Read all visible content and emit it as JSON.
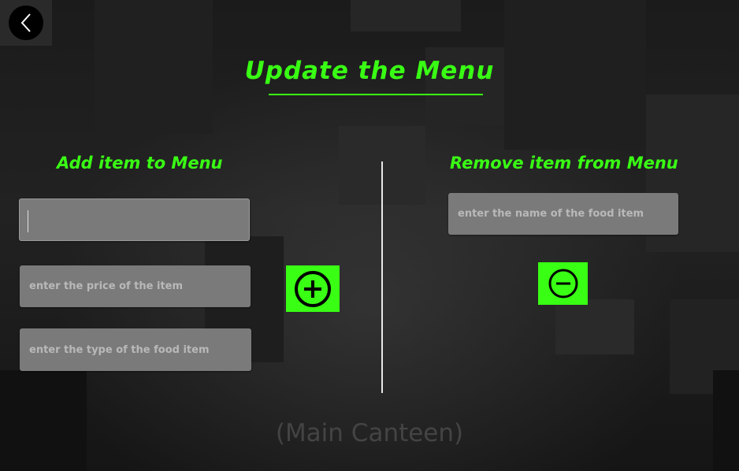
{
  "title": "Update the Menu",
  "add_section": {
    "heading": "Add item to Menu",
    "name_field": {
      "value": "",
      "placeholder": ""
    },
    "price_field": {
      "value": "",
      "placeholder": "enter the price of the item"
    },
    "type_field": {
      "value": "",
      "placeholder": "enter the type of the food item"
    },
    "add_icon": "plus-circle-icon"
  },
  "remove_section": {
    "heading": "Remove item from Menu",
    "name_field": {
      "value": "",
      "placeholder": "enter the name of the food item"
    },
    "remove_icon": "minus-circle-icon"
  },
  "back_icon": "chevron-left-icon",
  "footer": "(Main Canteen)",
  "colors": {
    "accent": "#39ff14",
    "field_bg": "#7a7a7a",
    "background": "#1c1c1c"
  }
}
